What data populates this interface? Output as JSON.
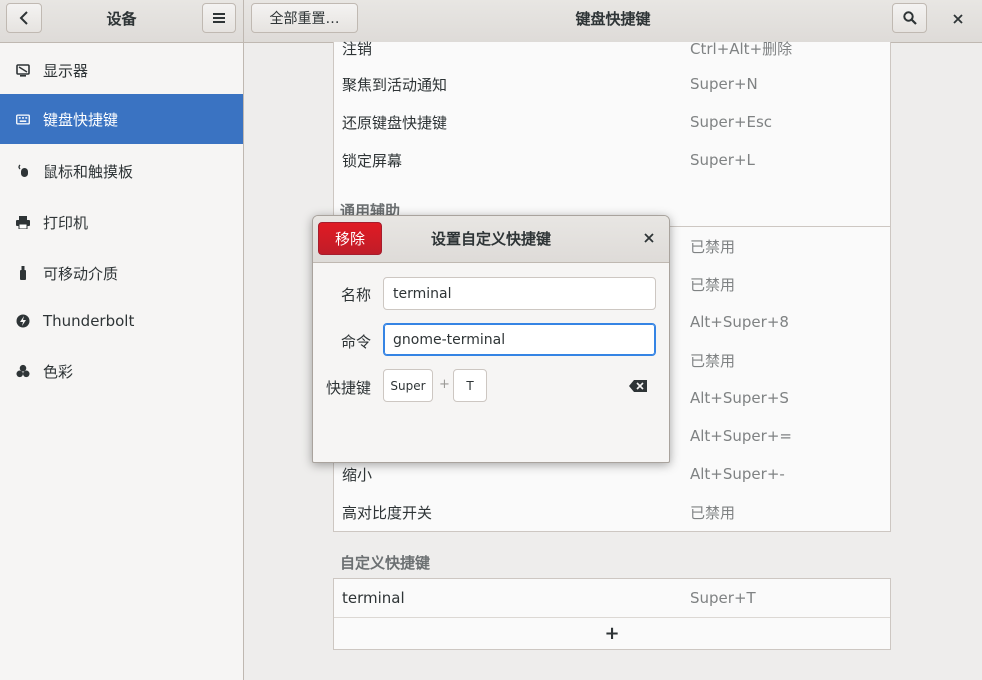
{
  "sidebar_header": {
    "title": "设备"
  },
  "main_header": {
    "title": "键盘快捷键",
    "reset_button": "全部重置…"
  },
  "sidebar": {
    "items": [
      {
        "label": "显示器",
        "icon": "display-icon"
      },
      {
        "label": "键盘快捷键",
        "icon": "keyboard-icon",
        "active": true
      },
      {
        "label": "鼠标和触摸板",
        "icon": "mouse-icon"
      },
      {
        "label": "打印机",
        "icon": "printer-icon"
      },
      {
        "label": "可移动介质",
        "icon": "removable-media-icon"
      },
      {
        "label": "Thunderbolt",
        "icon": "thunderbolt-icon"
      },
      {
        "label": "色彩",
        "icon": "color-icon"
      }
    ]
  },
  "shortcuts": {
    "system_rows": [
      {
        "name": "注销",
        "accel": "Ctrl+Alt+删除"
      },
      {
        "name": "聚焦到活动通知",
        "accel": "Super+N"
      },
      {
        "name": "还原键盘快捷键",
        "accel": "Super+Esc"
      },
      {
        "name": "锁定屏幕",
        "accel": "Super+L"
      }
    ],
    "accessibility_title": "通用辅助",
    "accessibility_rows": [
      {
        "name": "",
        "accel": "已禁用"
      },
      {
        "name": "",
        "accel": "已禁用"
      },
      {
        "name": "",
        "accel": "Alt+Super+8"
      },
      {
        "name": "",
        "accel": "已禁用"
      },
      {
        "name": "",
        "accel": "Alt+Super+S"
      },
      {
        "name": "",
        "accel": "Alt+Super+="
      },
      {
        "name": "缩小",
        "accel": "Alt+Super+-"
      },
      {
        "name": "高对比度开关",
        "accel": "已禁用"
      }
    ],
    "custom_title": "自定义快捷键",
    "custom_rows": [
      {
        "name": "terminal",
        "accel": "Super+T"
      }
    ],
    "add_label": "+"
  },
  "dialog": {
    "title": "设置自定义快捷键",
    "remove_button": "移除",
    "name_label": "名称",
    "name_value": "terminal",
    "command_label": "命令",
    "command_value": "gnome-terminal",
    "shortcut_label": "快捷键",
    "shortcut_keys": [
      "Super",
      "T"
    ],
    "plus": "+"
  }
}
